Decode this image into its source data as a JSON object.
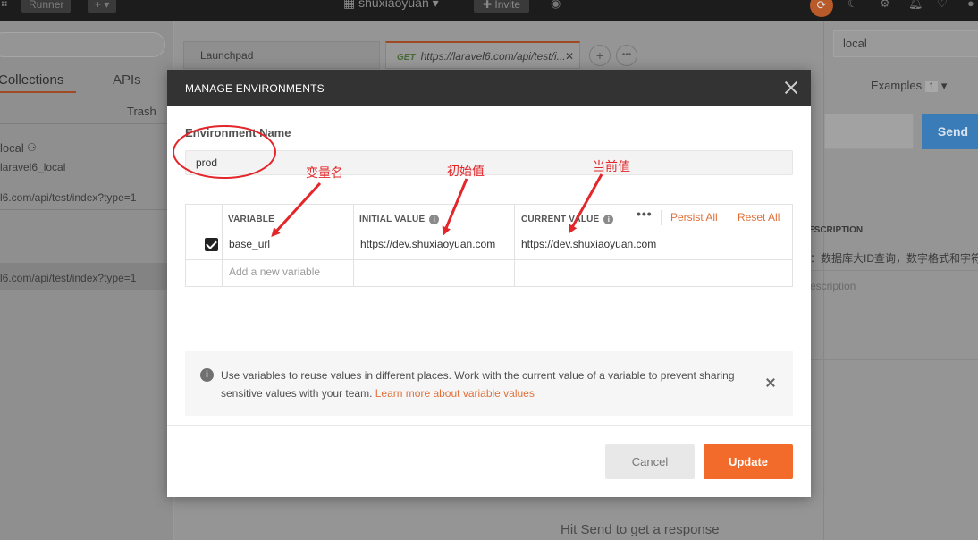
{
  "topbar": {
    "runner_label": "Runner",
    "workspace_name": "shuxiaoyuan",
    "invite_label": "Invite"
  },
  "sidebar": {
    "tabs": [
      {
        "label": "Collections"
      },
      {
        "label": "APIs"
      }
    ],
    "trash_label": "Trash",
    "items": [
      {
        "label": "local"
      },
      {
        "label": "laravel6_local"
      },
      {
        "label": "l6.com/api/test/index?type=1"
      },
      {
        "label": "l6.com/api/test/index?type=1"
      }
    ]
  },
  "main": {
    "tabs": [
      {
        "label": "Launchpad"
      },
      {
        "method": "GET",
        "label": "https://laravel6.com/api/test/i..."
      }
    ],
    "hit_send_text": "Hit Send to get a response"
  },
  "right_panel": {
    "environment": "local",
    "examples_label": "Examples",
    "examples_count": "1",
    "send_label": "Send",
    "description_header": "ESCRIPTION",
    "description_text": "：数据库大ID查询，数字格式和字符",
    "description_placeholder": "escription"
  },
  "modal": {
    "title": "MANAGE ENVIRONMENTS",
    "env_name_label": "Environment Name",
    "env_name_value": "prod",
    "table": {
      "headers": {
        "variable": "VARIABLE",
        "initial": "INITIAL VALUE",
        "current": "CURRENT VALUE"
      },
      "persist_all_label": "Persist All",
      "reset_all_label": "Reset All",
      "rows": [
        {
          "enabled": true,
          "variable": "base_url",
          "initial": "https://dev.shuxiaoyuan.com",
          "current": "https://dev.shuxiaoyuan.com"
        }
      ],
      "new_variable_placeholder": "Add a new variable"
    },
    "tip": {
      "text": "Use variables to reuse values in different places. Work with the current value of a variable to prevent sharing sensitive values with your team.",
      "link_text": "Learn more about variable values"
    },
    "cancel_label": "Cancel",
    "update_label": "Update"
  },
  "annotations": {
    "variable_name": "变量名",
    "initial_value": "初始值",
    "current_value": "当前值",
    "color": "#e3262a"
  },
  "colors": {
    "accent": "#f26b2a",
    "link": "#e0703a",
    "header": "#333333",
    "send": "#3a7cb8"
  }
}
